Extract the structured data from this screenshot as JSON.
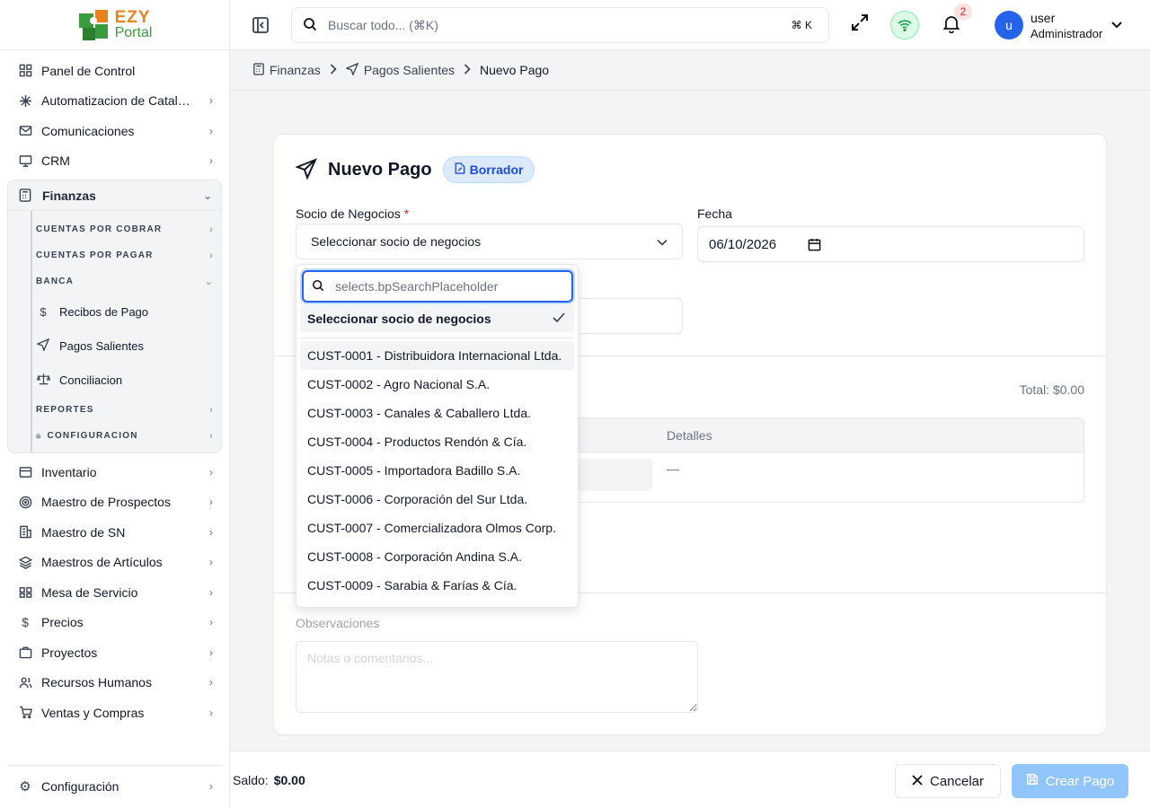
{
  "app": {
    "logo_top": "EZY",
    "logo_bottom": "Portal"
  },
  "sidebar": {
    "items_top": [
      {
        "label": "Panel de Control",
        "icon": "grid-icon"
      },
      {
        "label": "Automatizacion de Catalogo",
        "icon": "sparkle-icon"
      },
      {
        "label": "Comunicaciones",
        "icon": "mail-icon"
      },
      {
        "label": "CRM",
        "icon": "monitor-icon"
      }
    ],
    "finanzas": {
      "label": "Finanzas",
      "sections": {
        "cxc": "CUENTAS POR COBRAR",
        "cxp": "CUENTAS POR PAGAR",
        "banca": "BANCA",
        "reportes": "REPORTES",
        "configuracion": "CONFIGURACION"
      },
      "banca_items": {
        "recibos": "Recibos de Pago",
        "pagos": "Pagos Salientes",
        "conciliacion": "Conciliacion"
      }
    },
    "items_bottom": [
      {
        "label": "Inventario",
        "icon": "box-icon"
      },
      {
        "label": "Maestro de Prospectos",
        "icon": "target-icon"
      },
      {
        "label": "Maestro de SN",
        "icon": "building-icon"
      },
      {
        "label": "Maestros de Artículos",
        "icon": "layers-icon"
      },
      {
        "label": "Mesa de Servicio",
        "icon": "ticket-icon"
      },
      {
        "label": "Precios",
        "icon": "tag-icon"
      },
      {
        "label": "Proyectos",
        "icon": "briefcase-icon"
      },
      {
        "label": "Recursos Humanos",
        "icon": "users-icon"
      },
      {
        "label": "Ventas y Compras",
        "icon": "cart-icon"
      }
    ],
    "config": "Configuración"
  },
  "topbar": {
    "search_placeholder": "Buscar todo... (⌘K)",
    "kbd": "⌘ K",
    "notif_count": "2",
    "avatar_letter": "u",
    "user_name": "user",
    "user_role": "Administrador"
  },
  "breadcrumb": {
    "root": "Finanzas",
    "section": "Pagos Salientes",
    "current": "Nuevo Pago"
  },
  "form": {
    "title": "Nuevo Pago",
    "status": "Borrador",
    "partner_label": "Socio de Negocios",
    "required_mark": "*",
    "partner_value": "Seleccionar socio de negocios",
    "date_label": "Fecha",
    "date_value": "06/10/2026",
    "total": "Total: $0.00",
    "col_details": "Detalles",
    "details_empty": "—",
    "obs_label": "Observaciones",
    "obs_placeholder": "Notas o comentarios..."
  },
  "dropdown": {
    "search_placeholder": "selects.bpSearchPlaceholder",
    "selected": "Seleccionar socio de negocios",
    "options": [
      "CUST-0001 - Distribuidora Internacional Ltda.",
      "CUST-0002 - Agro Nacional S.A.",
      "CUST-0003 - Canales & Caballero Ltda.",
      "CUST-0004 - Productos Rendón & Cía.",
      "CUST-0005 - Importadora Badillo S.A.",
      "CUST-0006 - Corporación del Sur Ltda.",
      "CUST-0007 - Comercializadora Olmos Corp.",
      "CUST-0008 - Corporación Andina S.A.",
      "CUST-0009 - Sarabia & Farías & Cía."
    ]
  },
  "footer": {
    "saldo_label": "Saldo:",
    "saldo_value": "$0.00",
    "cancel": "Cancelar",
    "create": "Crear Pago"
  },
  "colors": {
    "accent": "#2563eb",
    "create_disabled": "#93c5fd",
    "brand_orange": "#e8821e",
    "brand_green": "#3a9b3d"
  }
}
